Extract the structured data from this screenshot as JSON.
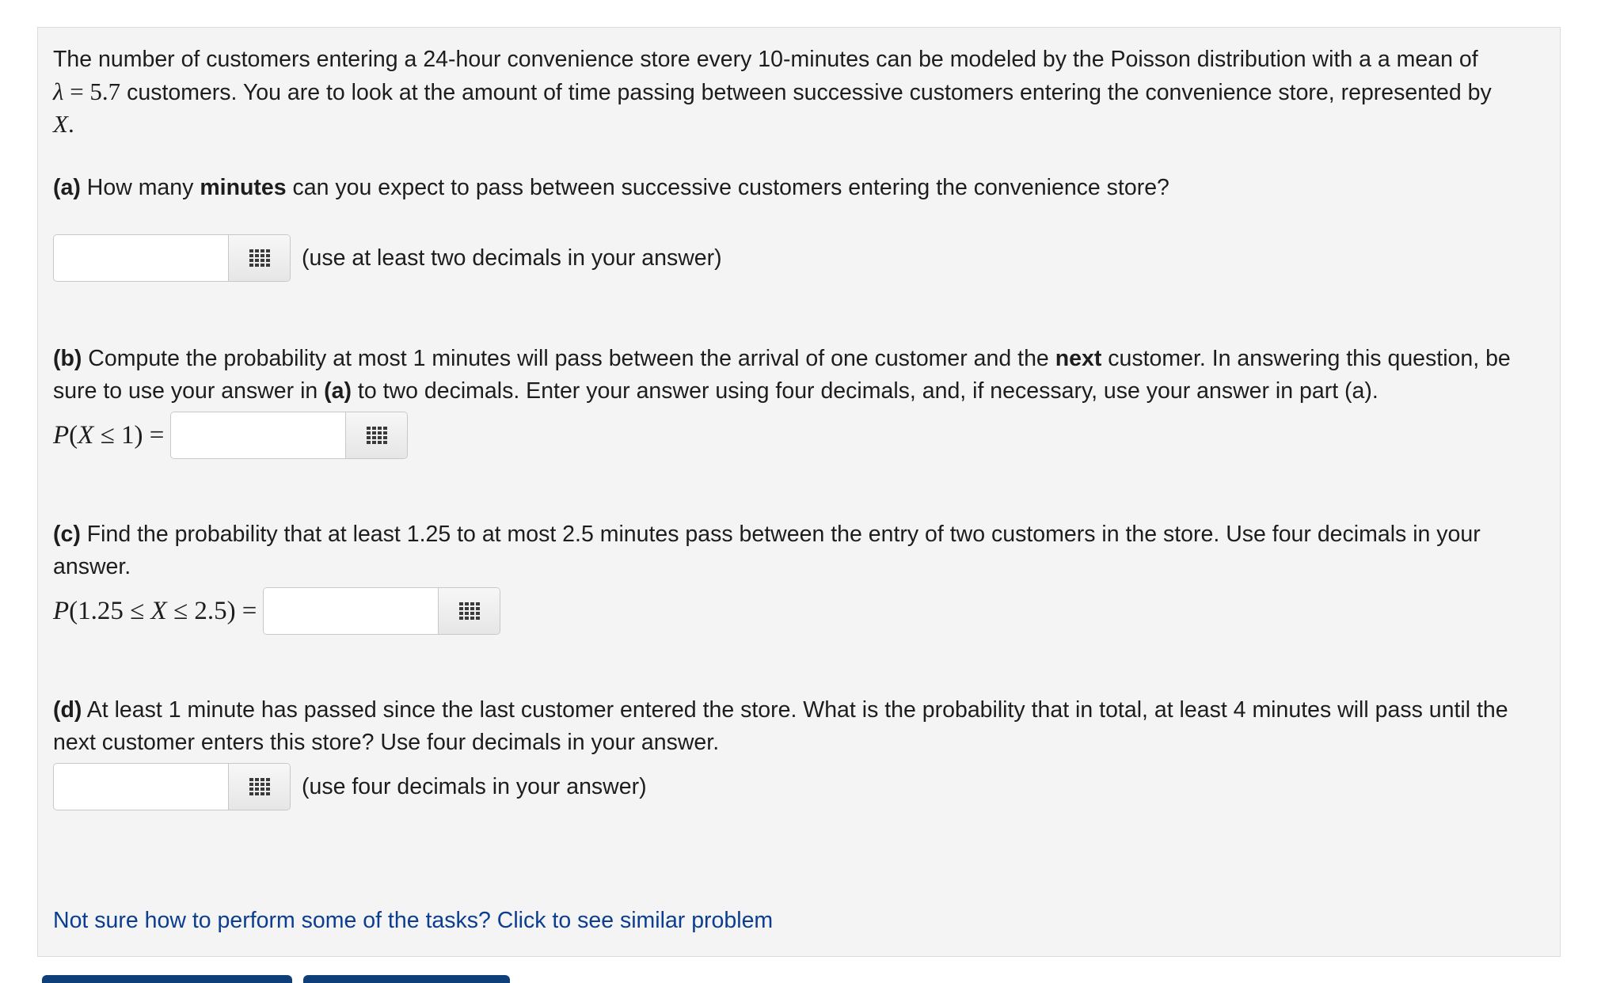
{
  "intro": {
    "text_before_lambda": "The number of customers entering a 24-hour convenience store every 10-minutes can be modeled by the Poisson distribution with a a mean of",
    "lambda_symbol": "λ",
    "lambda_eq": " = 5.7",
    "text_after_lambda": " customers. You are to look at the amount of time passing between successive customers entering the convenience store, represented by",
    "var_x": "X",
    "var_period": "."
  },
  "part_a": {
    "label": "(a)",
    "text_1": " How many ",
    "bold_word": "minutes",
    "text_2": " can you expect to pass between successive customers entering the convenience store?",
    "input_value": "",
    "hint": "(use at least two decimals in your answer)"
  },
  "part_b": {
    "label": "(b)",
    "text_1": " Compute the probability at most 1 minutes will pass between the arrival of one customer and the ",
    "bold_word": "next",
    "text_2": " customer. In answering this question, be sure to use your answer in ",
    "bold_ref": "(a)",
    "text_3": " to two decimals. Enter your answer using four decimals, and, if necessary, use your answer in part (a).",
    "eq_p": "P",
    "eq_rest_1": "(",
    "eq_x": "X",
    "eq_rest_2": " ≤ 1) =",
    "input_value": ""
  },
  "part_c": {
    "label": "(c)",
    "text_1": " Find the probability that at least 1.25 to at most 2.5 minutes pass between the entry of two customers in the store. Use four decimals in your answer.",
    "eq_p": "P",
    "eq_rest_1": "(1.25 ≤ ",
    "eq_x": "X",
    "eq_rest_2": " ≤ 2.5) =",
    "input_value": ""
  },
  "part_d": {
    "label": "(d)",
    "text_1": " At least 1 minute has passed since the last customer entered the store. What is the probability that in total, at least 4 minutes will pass until the next customer enters this store? Use four decimals in your answer.",
    "input_value": "",
    "hint": "(use four decimals in your answer)"
  },
  "help_link": "Not sure how to perform some of the tasks? Click to see similar problem",
  "icons": {
    "keypad": "keypad-grid-icon"
  },
  "colors": {
    "panel_bg": "#f4f4f4",
    "link": "#0b3d91",
    "button": "#1c4f8c"
  }
}
